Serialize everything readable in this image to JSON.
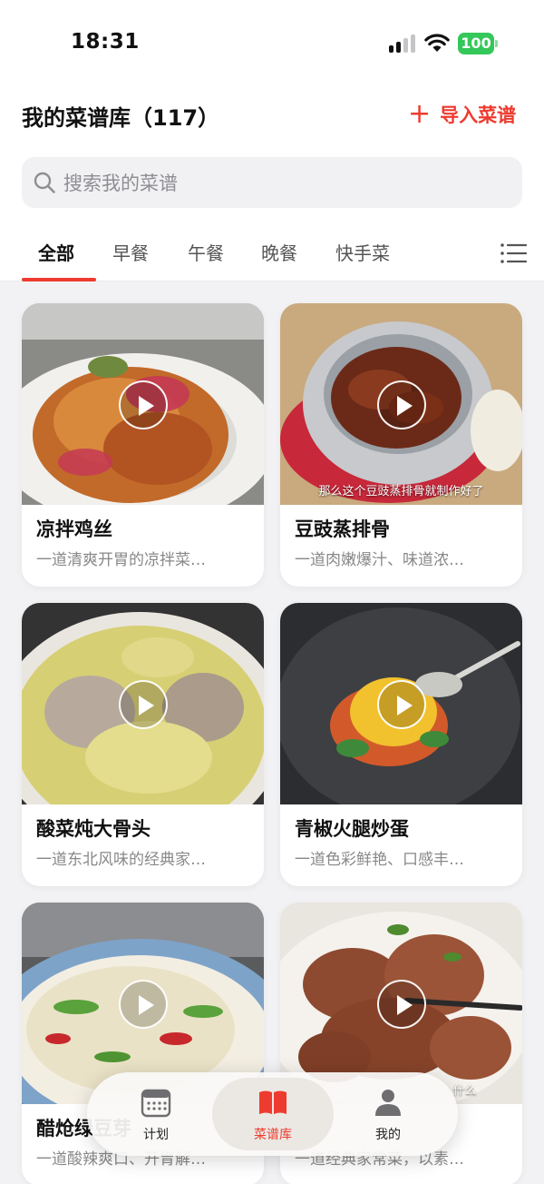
{
  "status_bar": {
    "time": "18:31",
    "battery": "100"
  },
  "header": {
    "title": "我的菜谱库（117）",
    "import_label": "导入菜谱"
  },
  "search": {
    "placeholder": "搜索我的菜谱"
  },
  "tabs": [
    {
      "label": "全部",
      "active": true
    },
    {
      "label": "早餐"
    },
    {
      "label": "午餐"
    },
    {
      "label": "晚餐"
    },
    {
      "label": "快手菜"
    }
  ],
  "recipes": [
    {
      "name": "凉拌鸡丝",
      "desc": "一道清爽开胃的凉拌菜…"
    },
    {
      "name": "豆豉蒸排骨",
      "desc": "一道肉嫩爆汁、味道浓…",
      "caption": "那么这个豆豉蒸排骨就制作好了"
    },
    {
      "name": "酸菜炖大骨头",
      "desc": "一道东北风味的经典家…"
    },
    {
      "name": "青椒火腿炒蛋",
      "desc": "一道色彩鲜艳、口感丰…"
    },
    {
      "name": "醋炝绿豆芽",
      "desc": "一道酸辣爽口、开胃解…"
    },
    {
      "name": "",
      "desc": "一道经典家常菜，以素…",
      "caption": "什么"
    }
  ],
  "bottom_nav": [
    {
      "label": "计划",
      "icon": "calendar-icon"
    },
    {
      "label": "菜谱库",
      "icon": "book-icon",
      "active": true
    },
    {
      "label": "我的",
      "icon": "person-icon"
    }
  ],
  "colors": {
    "accent": "#ee3b2f",
    "battery": "#34c759",
    "background": "#f2f2f4"
  }
}
